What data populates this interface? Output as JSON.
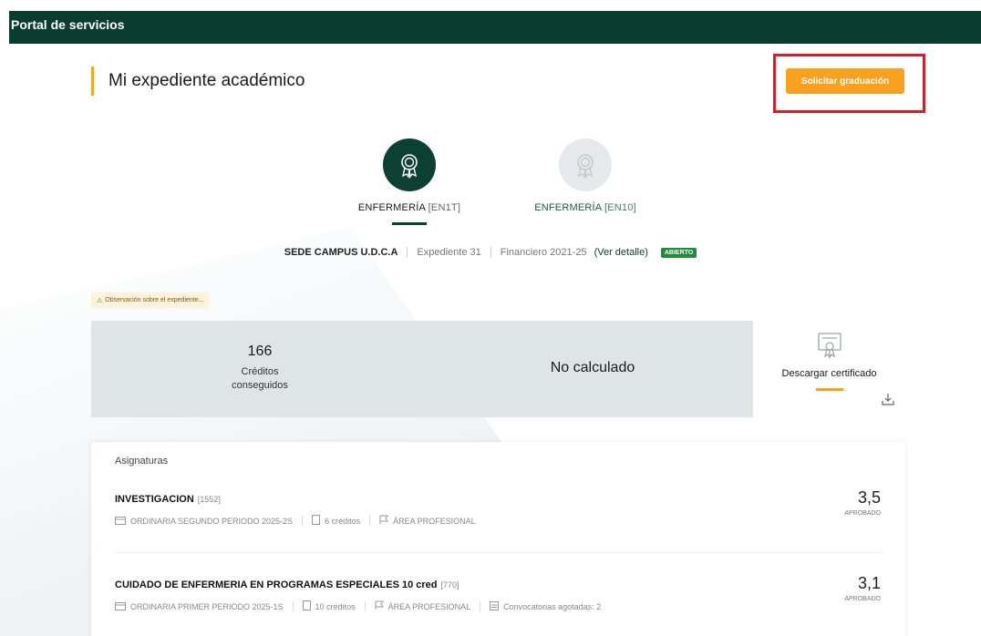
{
  "portal": {
    "title": "Portal de servicios"
  },
  "page": {
    "title": "Mi expediente académico"
  },
  "actions": {
    "request_graduation": "Solicitar graduación"
  },
  "programs": [
    {
      "name": "ENFERMERÍA",
      "code": "[EN1T]",
      "active": true
    },
    {
      "name": "ENFERMERÍA",
      "code": "[EN10]",
      "active": false
    }
  ],
  "record": {
    "campus": "SEDE CAMPUS U.D.C.A",
    "file": "Expediente 31",
    "financial": "Financiero 2021-25",
    "details_link": "(Ver detalle)",
    "status": "ABIERTO"
  },
  "observation": "Observación sobre el expediente...",
  "summary": {
    "credits_value": "166",
    "credits_label_1": "Créditos",
    "credits_label_2": "conseguidos",
    "average": "No calculado"
  },
  "certificate": {
    "label": "Descargar certificado"
  },
  "subjects": {
    "heading": "Asignaturas",
    "items": [
      {
        "name": "INVESTIGACION",
        "code": "[1552]",
        "call": "ORDINARIA SEGUNDO PERIODO 2025-2S",
        "credits": "6 créditos",
        "area": "ÁREA PROFESIONAL",
        "grade": "3,5",
        "status": "APROBADO"
      },
      {
        "name": "CUIDADO DE ENFERMERIA EN PROGRAMAS ESPECIALES 10 cred",
        "code": "[770]",
        "call": "ORDINARIA PRIMER PERIODO 2025-1S",
        "credits": "10 créditos",
        "area": "ÁREA PROFESIONAL",
        "exhausted": "Convocatorias agotadas: 2",
        "grade": "3,1",
        "status": "APROBADO"
      }
    ]
  },
  "colors": {
    "brand_dark_green": "#0b3d2e",
    "accent_orange": "#f7a11f",
    "highlight_red": "#d0202a",
    "status_green": "#1f8c3a"
  }
}
